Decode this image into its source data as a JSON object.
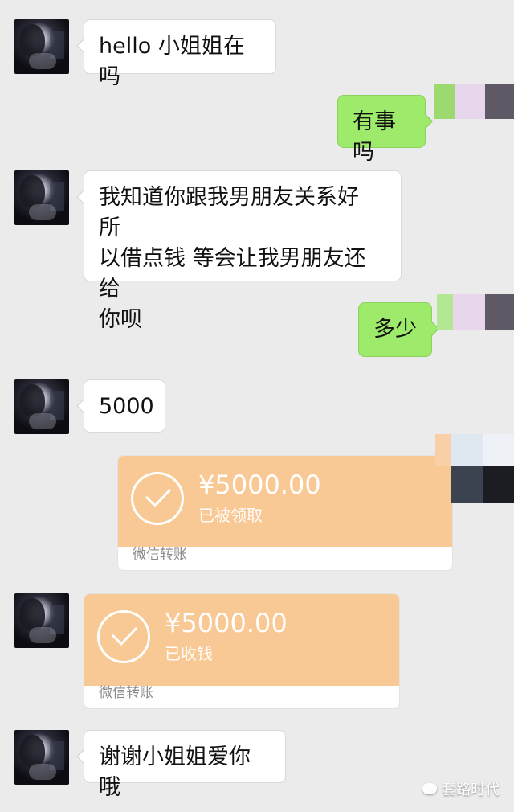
{
  "messages": [
    {
      "side": "left",
      "text": "hello 小姐姐在吗"
    },
    {
      "side": "right",
      "text": "有事吗"
    },
    {
      "side": "left",
      "text_lines": [
        "我知道你跟我男朋友关系好 所",
        "以借点钱 等会让我男朋友还给",
        "你呗"
      ]
    },
    {
      "side": "right",
      "text": "多少"
    },
    {
      "side": "left",
      "text": "5000"
    },
    {
      "side": "right",
      "type": "transfer",
      "amount": "¥5000.00",
      "status": "已被领取",
      "footer": "微信转账"
    },
    {
      "side": "left",
      "type": "transfer",
      "amount": "¥5000.00",
      "status": "已收钱",
      "footer": "微信转账"
    },
    {
      "side": "left",
      "text": "谢谢小姐姐爱你哦"
    }
  ],
  "watermark": {
    "text": "套路时代",
    "icon": "wechat-icon"
  },
  "colors": {
    "background": "#ebebeb",
    "left_bubble": "#ffffff",
    "right_bubble": "#9eea6a",
    "transfer_orange": "#f9c995"
  }
}
